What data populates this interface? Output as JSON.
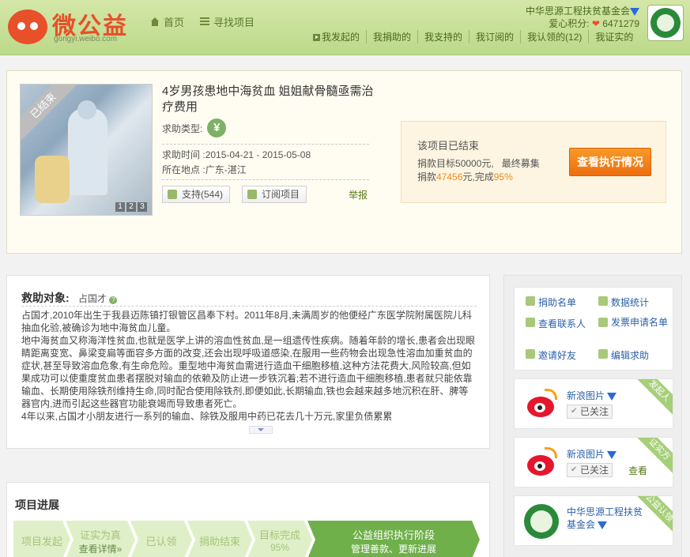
{
  "header": {
    "logo_text": "微公益",
    "logo_sub": "gongyi.weibo.com",
    "nav": [
      {
        "label": "首页"
      },
      {
        "label": "寻找项目"
      }
    ],
    "user_name": "中华思源工程扶贫基金会",
    "points_label": "爱心积分:",
    "points_value": "6471279",
    "subnav": [
      "我发起的",
      "我捐助的",
      "我支持的",
      "我订阅的",
      "我认领的(12)",
      "我证实的"
    ]
  },
  "project": {
    "ribbon": "已结束",
    "pager": [
      "1",
      "2",
      "3"
    ],
    "title": "4岁男孩患地中海贫血 姐姐献骨髓亟需治疗费用",
    "type_label": "求助类型:",
    "type_icon": "¥",
    "time_label": "求助时间",
    "time_value": ":2015-04-21 - 2015-05-08",
    "place_label": "所在地点",
    "place_value": ":广东-湛江",
    "support_label": "支持(544)",
    "subscribe_label": "订阅项目",
    "report_label": "举报",
    "status_title": "该项目已结束",
    "goal_prefix": "捐款目标",
    "goal_value": "50000",
    "goal_unit": "元,",
    "final_label": "最终募集",
    "raised_prefix": "捐款",
    "raised_value": "47456",
    "raised_unit": "元,完成",
    "percent": "95%",
    "exec_button": "查看执行情况"
  },
  "description": {
    "heading": "救助对象:",
    "name": "占国才",
    "paragraphs": [
      "占国才,2010年出生于我县迈陈镇打银管区昌奉下村。2011年8月,未满周岁的他便经广东医学院附属医院儿科抽血化验,被确诊为地中海贫血儿童。",
      "地中海贫血又称海洋性贫血,也就是医学上讲的溶血性贫血,是一组遗传性疾病。随着年龄的增长,患者会出现眼睛距离变宽、鼻梁变扁等面容多方面的改变,还会出现呼吸道感染,在服用一些药物会出现急性溶血加重贫血的症状,甚至导致溶血危象,有生命危险。重型地中海贫血需进行造血干细胞移植,这种方法花费大,风险较高,但如果成功可以使重度贫血患者摆脱对输血的依赖及防止进一步铁沉着;若不进行造血干细胞移植,患者就只能依靠输血、长期使用除铁剂维持生命,同时配合使用除铁剂,即便如此,长期输血,铁也会越来越多地沉积在肝、脾等器官内,进而引起这些器官功能衰竭而导致患者死亡。",
      "4年以来,占国才小朋友进行一系列的输血、除铁及服用中药已花去几十万元,家里负债累累"
    ]
  },
  "progress": {
    "heading": "项目进展",
    "steps": [
      {
        "label": "项目发起",
        "sub": ""
      },
      {
        "label": "证实为真",
        "sub": "查看详情»"
      },
      {
        "label": "已认领",
        "sub": ""
      },
      {
        "label": "捐助结束",
        "sub": ""
      },
      {
        "label": "目标完成",
        "sub": "95%"
      },
      {
        "label": "公益组织执行阶段",
        "sub": "管理善款、更新进展"
      }
    ]
  },
  "sidebar": {
    "actions": [
      "捐助名单",
      "数据统计",
      "查看联系人",
      "发票申请名单",
      "邀请好友",
      "编辑求助"
    ],
    "cards": [
      {
        "name": "新浪图片",
        "follow": "已关注",
        "view": "",
        "corner": "发起人"
      },
      {
        "name": "新浪图片",
        "follow": "已关注",
        "view": "查看",
        "corner": "证实方"
      },
      {
        "name": "中华思源工程扶贫基金会",
        "corner": "公益认领"
      }
    ]
  }
}
